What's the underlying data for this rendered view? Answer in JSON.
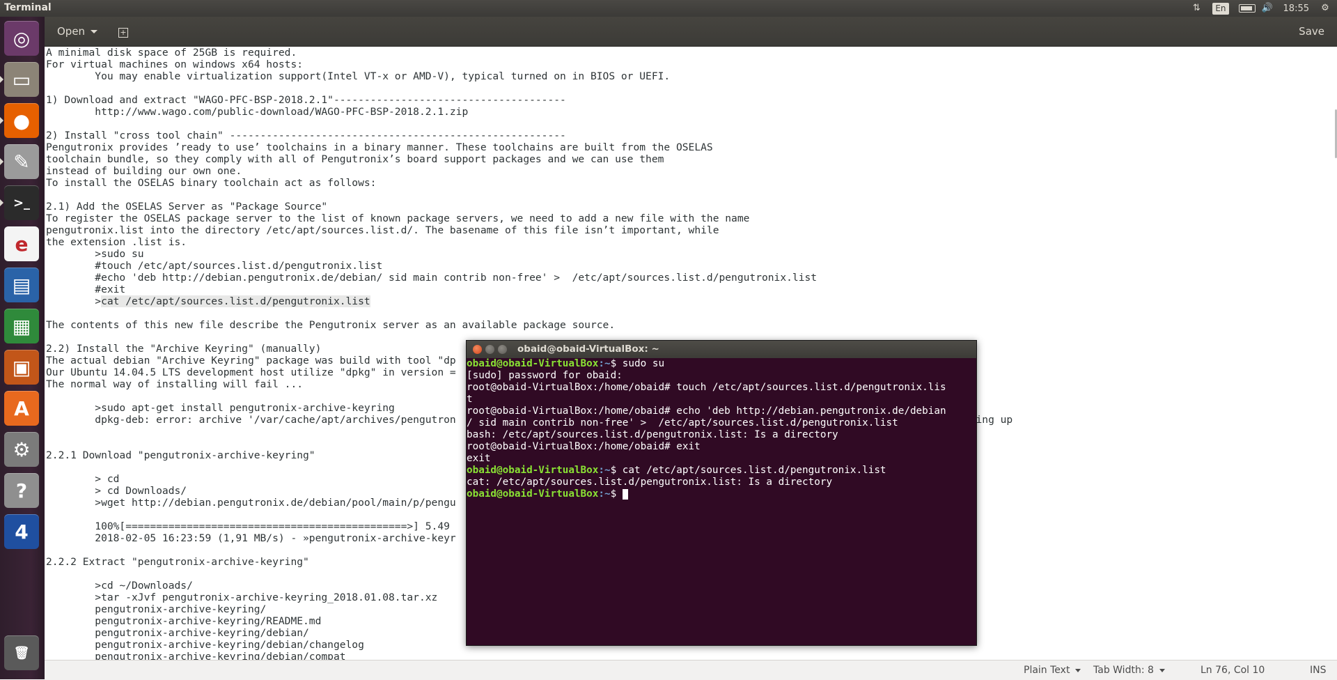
{
  "topbar": {
    "app_title": "Terminal",
    "keyboard_layout": "En",
    "time": "18:55"
  },
  "launcher": {
    "items": [
      {
        "name": "ubuntu-dash",
        "glyph": "◎",
        "color": "#6b3a69"
      },
      {
        "name": "files",
        "glyph": "▭",
        "color": "#8c8477"
      },
      {
        "name": "firefox",
        "glyph": "●",
        "color": "#e66000"
      },
      {
        "name": "text-editor",
        "glyph": "✎",
        "color": "#9b9b9b"
      },
      {
        "name": "terminal",
        "glyph": ">_",
        "color": "#2b2b2b"
      },
      {
        "name": "document-viewer",
        "glyph": "e",
        "color": "#f4f4f4"
      },
      {
        "name": "libreoffice-writer",
        "glyph": "▤",
        "color": "#2a63a8"
      },
      {
        "name": "libreoffice-calc",
        "glyph": "▦",
        "color": "#2f8a3b"
      },
      {
        "name": "libreoffice-impress",
        "glyph": "▣",
        "color": "#c25619"
      },
      {
        "name": "software-center",
        "glyph": "A",
        "color": "#e8691e"
      },
      {
        "name": "system-settings",
        "glyph": "⚙",
        "color": "#7b7b7b"
      },
      {
        "name": "help",
        "glyph": "?",
        "color": "#8f8f8f"
      },
      {
        "name": "app-4",
        "glyph": "4",
        "color": "#1f4fa0"
      },
      {
        "name": "trash",
        "glyph": "🗑",
        "color": "#5a5a5a"
      }
    ]
  },
  "gedit": {
    "open_label": "Open",
    "save_label": "Save",
    "lines": [
      "A minimal disk space of 25GB is required.",
      "For virtual machines on windows x64 hosts:",
      "        You may enable virtualization support(Intel VT-x or AMD-V), typical turned on in BIOS or UEFI.",
      "",
      "1) Download and extract \"WAGO-PFC-BSP-2018.2.1\"--------------------------------------",
      "        http://www.wago.com/public-download/WAGO-PFC-BSP-2018.2.1.zip",
      "",
      "2) Install \"cross tool chain\" -------------------------------------------------------",
      "Pengutronix provides ’ready to use’ toolchains in a binary manner. These toolchains are built from the OSELAS",
      "toolchain bundle, so they comply with all of Pengutronix’s board support packages and we can use them",
      "instead of building our own one.",
      "To install the OSELAS binary toolchain act as follows:",
      "",
      "2.1) Add the OSELAS Server as \"Package Source\"",
      "To register the OSELAS package server to the list of known package servers, we need to add a new file with the name",
      "pengutronix.list into the directory /etc/apt/sources.list.d/. The basename of this file isn’t important, while",
      "the extension .list is.",
      "        >sudo su",
      "        #touch /etc/apt/sources.list.d/pengutronix.list",
      "        #echo 'deb http://debian.pengutronix.de/debian/ sid main contrib non-free' >  /etc/apt/sources.list.d/pengutronix.list",
      "        #exit",
      "        >cat /etc/apt/sources.list.d/pengutronix.list",
      "",
      "The contents of this new file describe the Pengutronix server as an available package source.",
      "",
      "2.2) Install the \"Archive Keyring\" (manually)",
      "The actual debian \"Archive Keyring\" package was build with tool \"dp",
      "Our Ubuntu 14.04.5 LTS development host utilize \"dpkg\" in version =",
      "The normal way of installing will fail ...",
      "",
      "        >sudo apt-get install pengutronix-archive-keyring",
      "        dpkg-deb: error: archive '/var/cache/apt/archives/pengutron                                                             re 'control.tar.gz', giving up",
      "",
      "",
      "2.2.1 Download \"pengutronix-archive-keyring\"",
      "",
      "        > cd",
      "        > cd Downloads/",
      "        >wget http://debian.pengutronix.de/debian/pool/main/p/pengu",
      "",
      "        100%[==============================================>] 5.49",
      "        2018-02-05 16:23:59 (1,91 MB/s) - »pengutronix-archive-keyr",
      "",
      "2.2.2 Extract \"pengutronix-archive-keyring\"",
      "",
      "        >cd ~/Downloads/",
      "        >tar -xJvf pengutronix-archive-keyring_2018.01.08.tar.xz",
      "        pengutronix-archive-keyring/",
      "        pengutronix-archive-keyring/README.md",
      "        pengutronix-archive-keyring/debian/",
      "        pengutronix-archive-keyring/debian/changelog",
      "        pengutronix-archive-keyring/debian/compat"
    ],
    "highlight_line_index": 21,
    "status": {
      "syntax": "Plain Text",
      "tab_width": "Tab Width: 8",
      "position": "Ln 76, Col 10",
      "mode": "INS"
    }
  },
  "terminal": {
    "title": "obaid@obaid-VirtualBox: ~",
    "lines": [
      {
        "prompt_user": "obaid@obaid-VirtualBox",
        "prompt_path": ":~",
        "text": "$ sudo su"
      },
      {
        "text": "[sudo] password for obaid:"
      },
      {
        "text": "root@obaid-VirtualBox:/home/obaid# touch /etc/apt/sources.list.d/pengutronix.lis"
      },
      {
        "text": "t"
      },
      {
        "text": "root@obaid-VirtualBox:/home/obaid# echo 'deb http://debian.pengutronix.de/debian"
      },
      {
        "text": "/ sid main contrib non-free' >  /etc/apt/sources.list.d/pengutronix.list"
      },
      {
        "text": "bash: /etc/apt/sources.list.d/pengutronix.list: Is a directory"
      },
      {
        "text": "root@obaid-VirtualBox:/home/obaid# exit"
      },
      {
        "text": "exit"
      },
      {
        "prompt_user": "obaid@obaid-VirtualBox",
        "prompt_path": ":~",
        "text": "$ cat /etc/apt/sources.list.d/pengutronix.list"
      },
      {
        "text": "cat: /etc/apt/sources.list.d/pengutronix.list: Is a directory"
      },
      {
        "prompt_user": "obaid@obaid-VirtualBox",
        "prompt_path": ":~",
        "text": "$ ",
        "cursor": true
      }
    ]
  }
}
